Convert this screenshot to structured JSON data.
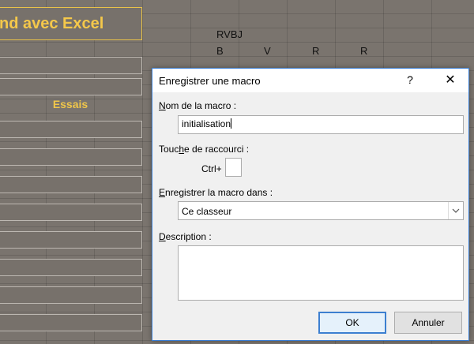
{
  "sheet": {
    "title": "nd avec Excel",
    "essais": "Essais",
    "header1": "RVBJ",
    "row": [
      "B",
      "V",
      "R",
      "R"
    ]
  },
  "dialog": {
    "title": "Enregistrer une macro",
    "help": "?",
    "close": "✕",
    "name_label_u": "N",
    "name_label_rest": "om de la macro :",
    "name_value": "initialisation",
    "shortcut_label_pre": "Touc",
    "shortcut_label_u": "h",
    "shortcut_label_rest": "e de raccourci :",
    "ctrl_label": "Ctrl+",
    "shortcut_value": "",
    "store_label_u": "E",
    "store_label_rest": "nregistrer la macro dans :",
    "store_value": "Ce classeur",
    "desc_label_u": "D",
    "desc_label_rest": "escription :",
    "desc_value": "",
    "ok_label": "OK",
    "cancel_label": "Annuler"
  },
  "colors": {
    "accent": "#3c7fd0",
    "sheet_bg": "#7a746e",
    "gold": "#f5c84a"
  }
}
